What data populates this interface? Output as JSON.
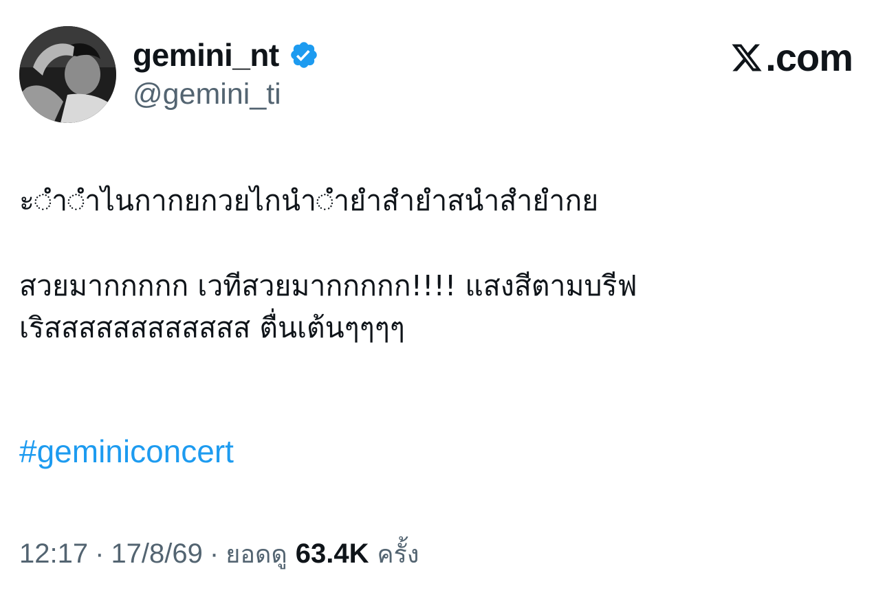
{
  "user": {
    "display_name": "gemini_nt",
    "handle": "@gemini_ti",
    "verified": true,
    "verified_color": "#1d9bf0",
    "avatar": "profile-photo-monochrome"
  },
  "brand": {
    "logo_icon": "x-logo-icon",
    "domain": ".com"
  },
  "tweet": {
    "lines": [
      "ะ◌ํา◌ําไนกากยกวยไกนํา◌ํายําสํายําสนําสํายํากย",
      "สวยมากกกกก เวทีสวยมากกกกก!!!! แสงสีตามบรีฟ",
      "เริสสสสสสสสสสสส ตื่นเต้นๆๆๆๆ"
    ],
    "hashtag": "#geminiconcert"
  },
  "meta": {
    "time": "12:17",
    "separator": "·",
    "date": "17/8/69",
    "views_label": "ยอดดู",
    "views_count": "63.4K",
    "views_suffix": "ครั้ง"
  },
  "colors": {
    "text_primary": "#0f1419",
    "text_secondary": "#536471",
    "link": "#1d9bf0"
  }
}
